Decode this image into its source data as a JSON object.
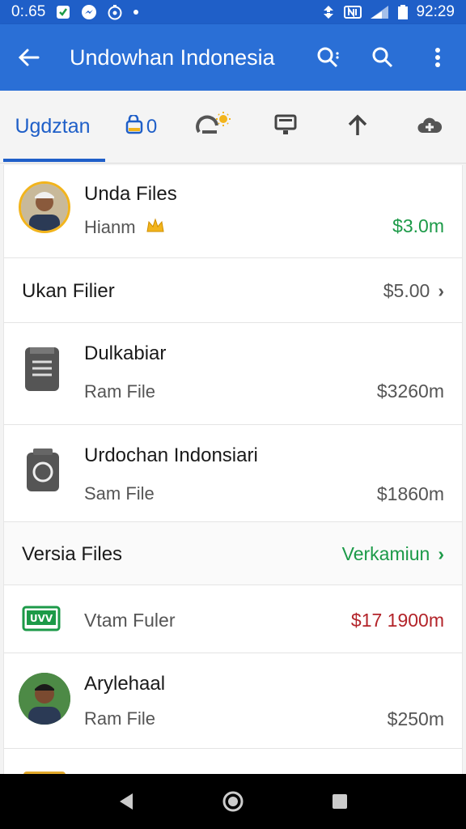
{
  "status_bar": {
    "time": "0:.65",
    "clock": "92:29"
  },
  "app_bar": {
    "title": "Undowhan Indonesia"
  },
  "tabs": {
    "active_label": "Ugdztan",
    "second_label": "0"
  },
  "rows": [
    {
      "title": "Unda Files",
      "subtitle": "Hianm",
      "amount": "$3.0m",
      "amount_color": "#1c9a48"
    },
    {
      "title": "Ukan Filier",
      "amount": "$5.00"
    },
    {
      "title": "Dulkabiar",
      "subtitle": "Ram File",
      "amount": "$3260m"
    },
    {
      "title": "Urdochan Indonsiari",
      "subtitle": "Sam File",
      "amount": "$1860m"
    },
    {
      "title": "Versia Files",
      "action": "Verkamiun",
      "action_color": "#1c9a48"
    },
    {
      "title": "Vtam Fuler",
      "amount": "$17 1900m",
      "amount_color": "#b3242a",
      "badge": "UVV"
    },
    {
      "title": "Arylehaal",
      "subtitle": "Ram File",
      "amount": "$250m"
    }
  ],
  "colors": {
    "app_bar": "#2a6fd6",
    "accent": "#1f5fc8",
    "positive": "#1c9a48",
    "negative": "#b3242a"
  }
}
